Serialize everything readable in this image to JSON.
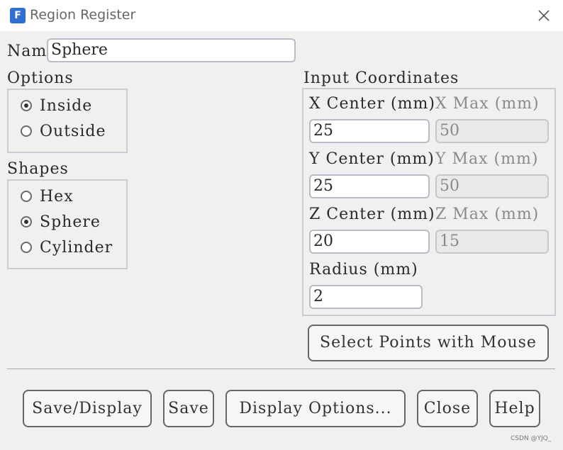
{
  "window": {
    "title": "Region Register",
    "app_icon_letter": "F"
  },
  "name_field": {
    "label": "Name",
    "value": "Sphere"
  },
  "options": {
    "title": "Options",
    "items": [
      {
        "label": "Inside",
        "selected": true
      },
      {
        "label": "Outside",
        "selected": false
      }
    ]
  },
  "shapes": {
    "title": "Shapes",
    "items": [
      {
        "label": "Hex",
        "selected": false
      },
      {
        "label": "Sphere",
        "selected": true
      },
      {
        "label": "Cylinder",
        "selected": false
      }
    ]
  },
  "coords": {
    "title": "Input Coordinates",
    "x_center_label": "X Center (mm)",
    "x_center_value": "25",
    "x_max_label": "X Max (mm)",
    "x_max_value": "50",
    "y_center_label": "Y Center (mm)",
    "y_center_value": "25",
    "y_max_label": "Y Max (mm)",
    "y_max_value": "50",
    "z_center_label": "Z Center (mm)",
    "z_center_value": "20",
    "z_max_label": "Z Max (mm)",
    "z_max_value": "15",
    "radius_label": "Radius (mm)",
    "radius_value": "2"
  },
  "select_points_label": "Select Points with Mouse",
  "buttons": {
    "save_display": "Save/Display",
    "save": "Save",
    "display_options": "Display Options...",
    "close": "Close",
    "help": "Help"
  },
  "watermark": "CSDN @YJQ_"
}
